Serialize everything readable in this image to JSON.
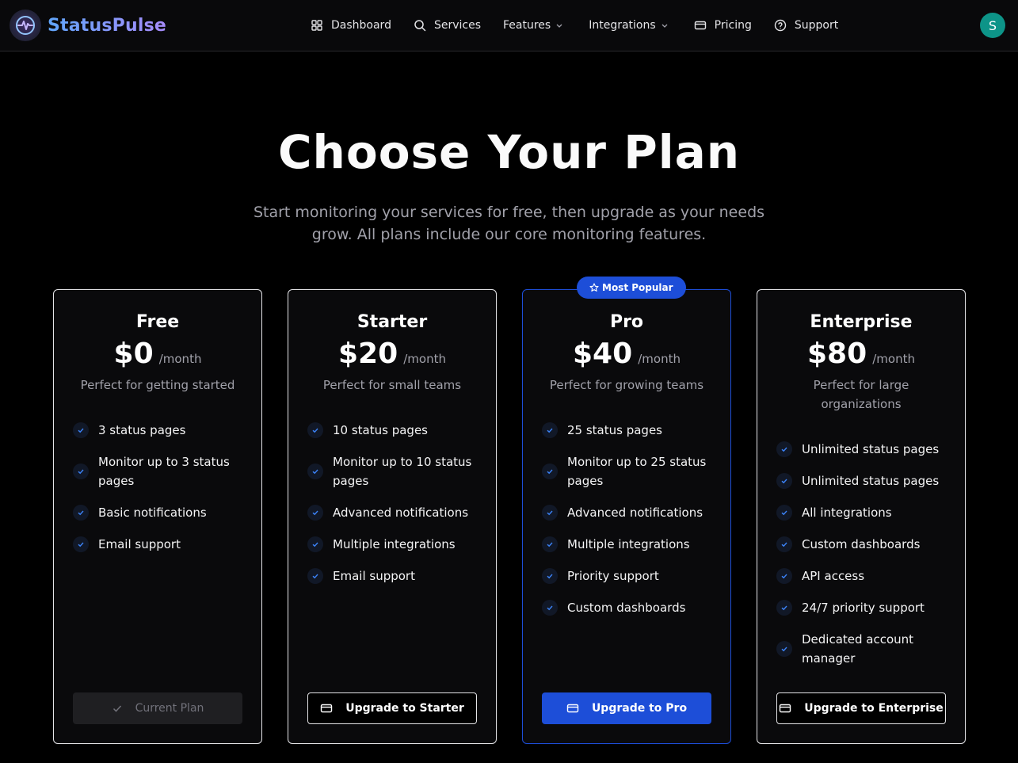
{
  "brand": {
    "name": "StatusPulse",
    "accent": "#60a5fa"
  },
  "nav": {
    "dashboard": "Dashboard",
    "services": "Services",
    "features": "Features",
    "integrations": "Integrations",
    "pricing": "Pricing",
    "support": "Support"
  },
  "user": {
    "initial": "S",
    "avatar_color": "#0d9488"
  },
  "hero": {
    "title": "Choose Your Plan",
    "subtitle": "Start monitoring your services for free, then upgrade as your needs grow. All plans include our core monitoring features."
  },
  "plans": [
    {
      "name": "Free",
      "price": "$0",
      "period": "/month",
      "description": "Perfect for getting started",
      "features": [
        "3 status pages",
        "Monitor up to 3 status pages",
        "Basic notifications",
        "Email support"
      ],
      "button": "Current Plan"
    },
    {
      "name": "Starter",
      "price": "$20",
      "period": "/month",
      "description": "Perfect for small teams",
      "features": [
        "10 status pages",
        "Monitor up to 10 status pages",
        "Advanced notifications",
        "Multiple integrations",
        "Email support"
      ],
      "button": "Upgrade to Starter"
    },
    {
      "name": "Pro",
      "price": "$40",
      "period": "/month",
      "description": "Perfect for growing teams",
      "badge": "Most Popular",
      "features": [
        "25 status pages",
        "Monitor up to 25 status pages",
        "Advanced notifications",
        "Multiple integrations",
        "Priority support",
        "Custom dashboards"
      ],
      "button": "Upgrade to Pro"
    },
    {
      "name": "Enterprise",
      "price": "$80",
      "period": "/month",
      "description": "Perfect for large organizations",
      "features": [
        "Unlimited status pages",
        "Unlimited status pages",
        "All integrations",
        "Custom dashboards",
        "API access",
        "24/7 priority support",
        "Dedicated account manager"
      ],
      "button": "Upgrade to Enterprise"
    }
  ],
  "colors": {
    "primary": "#1d4ed8",
    "background": "#000000",
    "card_border": "#e4e4e7"
  }
}
